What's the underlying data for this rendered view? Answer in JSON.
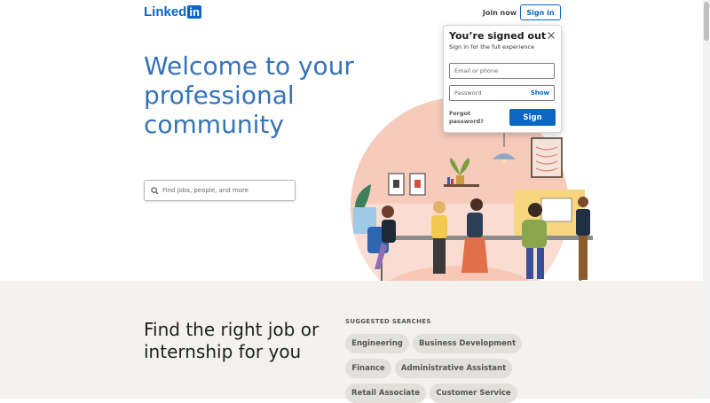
{
  "header": {
    "logo_text": "Linked",
    "logo_badge": "in",
    "join_label": "Join now",
    "signin_label": "Sign in"
  },
  "hero": {
    "title": "Welcome to your professional community",
    "search_placeholder": "Find jobs, people, and more"
  },
  "popup": {
    "title": "You’re signed out",
    "subtitle": "Sign in for the full experience",
    "email_placeholder": "Email or phone",
    "password_placeholder": "Password",
    "show_label": "Show",
    "forgot_label": "Forgot password?",
    "sign_button": "Sign"
  },
  "jobs": {
    "title": "Find the right job or internship for you",
    "suggested_label": "SUGGESTED SEARCHES",
    "pills": [
      "Engineering",
      "Business Development",
      "Finance",
      "Administrative Assistant",
      "Retail Associate",
      "Customer Service"
    ]
  },
  "colors": {
    "brand": "#0a66c2",
    "hero_text": "#3572b7",
    "band": "#f4f2ee",
    "pill": "#e2e0db",
    "illustration_circle": "#f6cbbc"
  }
}
